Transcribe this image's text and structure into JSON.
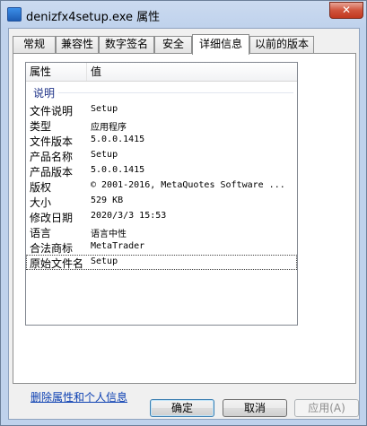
{
  "window": {
    "title": "denizfx4setup.exe 属性",
    "close_label": "✕"
  },
  "tabs": [
    {
      "label": "常规"
    },
    {
      "label": "兼容性"
    },
    {
      "label": "数字签名"
    },
    {
      "label": "安全"
    },
    {
      "label": "详细信息",
      "active": true
    },
    {
      "label": "以前的版本"
    }
  ],
  "details": {
    "col_property": "属性",
    "col_value": "值",
    "group": "说明",
    "rows": [
      {
        "name": "文件说明",
        "value": "Setup"
      },
      {
        "name": "类型",
        "value": "应用程序"
      },
      {
        "name": "文件版本",
        "value": "5.0.0.1415"
      },
      {
        "name": "产品名称",
        "value": "Setup"
      },
      {
        "name": "产品版本",
        "value": "5.0.0.1415"
      },
      {
        "name": "版权",
        "value": "© 2001-2016, MetaQuotes Software ..."
      },
      {
        "name": "大小",
        "value": "529 KB"
      },
      {
        "name": "修改日期",
        "value": "2020/3/3 15:53"
      },
      {
        "name": "语言",
        "value": "语言中性"
      },
      {
        "name": "合法商标",
        "value": "MetaTrader"
      },
      {
        "name": "原始文件名",
        "value": "Setup",
        "selected": true
      }
    ]
  },
  "remove_link": "删除属性和个人信息",
  "buttons": {
    "ok": "确定",
    "cancel": "取消",
    "apply": "应用(A)"
  },
  "colors": {
    "link": "#0b3fb2",
    "group_header": "#1e3287",
    "close_button": "#c1381f"
  }
}
